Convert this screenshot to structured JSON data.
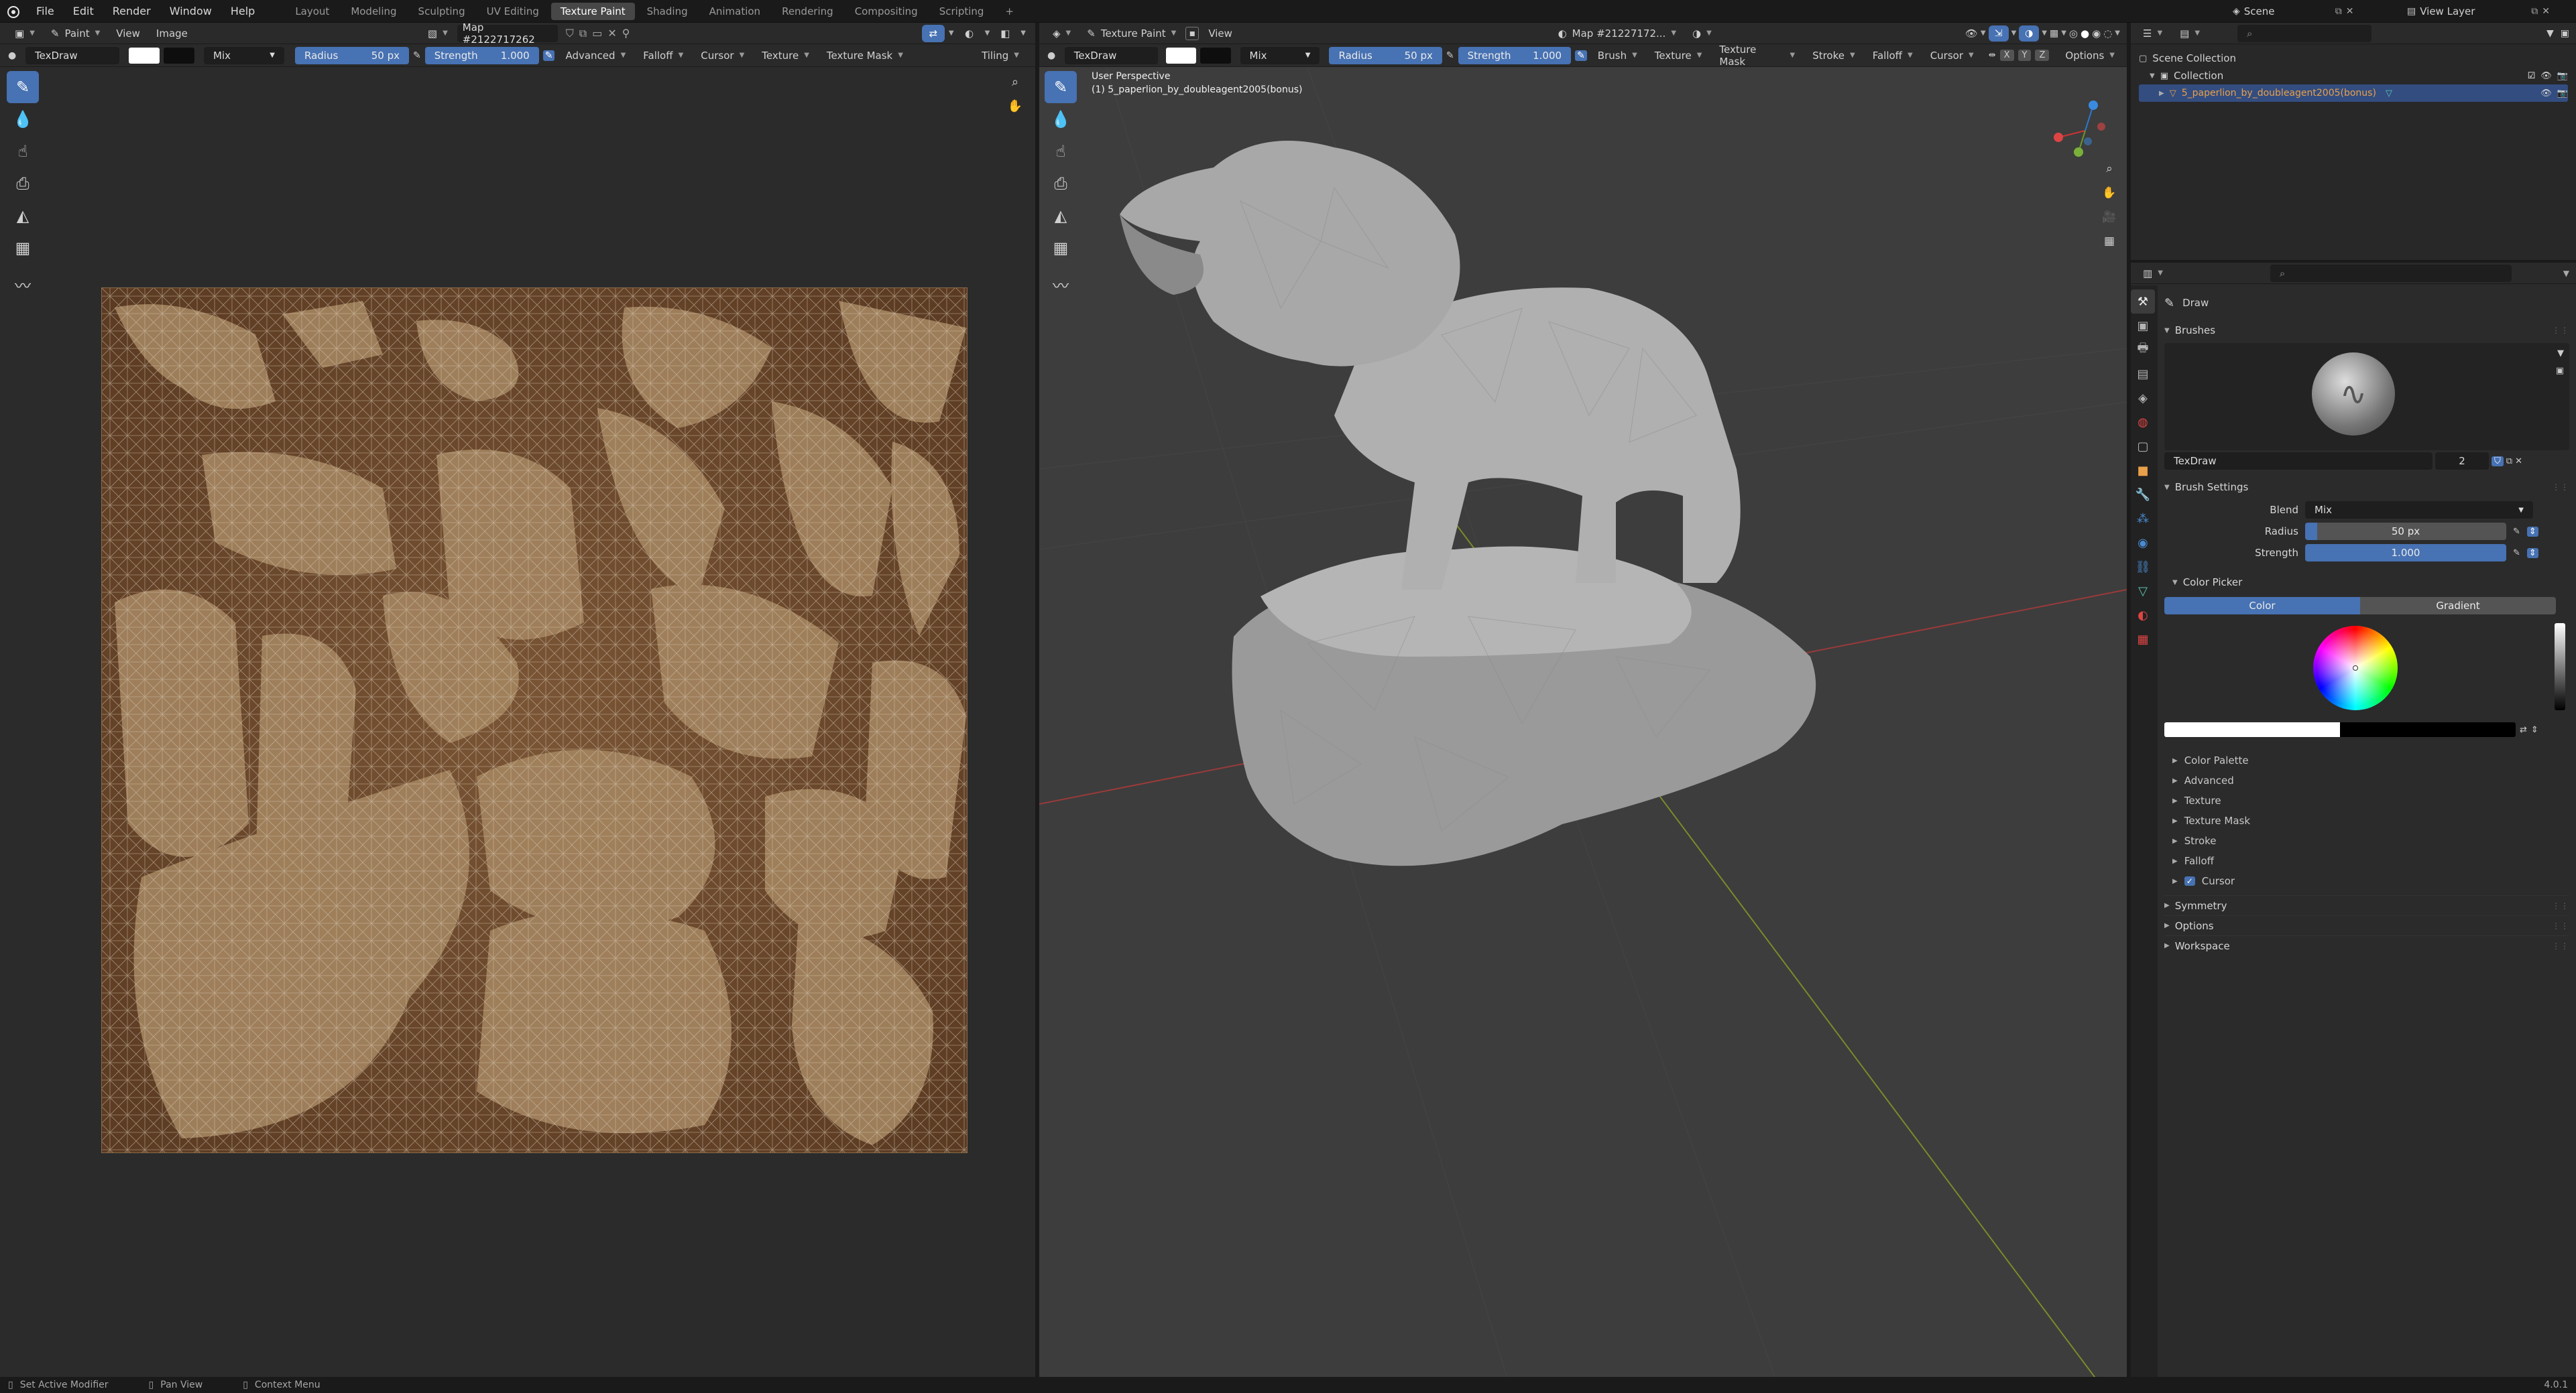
{
  "menubar": {
    "menus": [
      "File",
      "Edit",
      "Render",
      "Window",
      "Help"
    ],
    "workspaces": [
      "Layout",
      "Modeling",
      "Sculpting",
      "UV Editing",
      "Texture Paint",
      "Shading",
      "Animation",
      "Rendering",
      "Compositing",
      "Scripting"
    ],
    "active_workspace": "Texture Paint",
    "add_workspace": "+",
    "scene_label": "Scene",
    "view_layer_label": "View Layer"
  },
  "image_editor": {
    "mode": "Paint",
    "menus": [
      "View",
      "Image"
    ],
    "image_name": "Map #2122717262",
    "tool_header": {
      "brush": "TexDraw",
      "blend": "Mix",
      "radius_label": "Radius",
      "radius_value": "50 px",
      "strength_label": "Strength",
      "strength_value": "1.000",
      "menus": [
        "Advanced",
        "Falloff",
        "Cursor",
        "Texture",
        "Texture Mask"
      ],
      "tiling": "Tiling"
    },
    "tools": [
      "draw-tool",
      "soften-tool",
      "smear-tool",
      "clone-tool",
      "fill-tool",
      "mask-tool",
      "annotate-tool"
    ]
  },
  "viewport": {
    "mode": "Texture Paint",
    "menus": [
      "View"
    ],
    "image_name": "Map #21227172...",
    "tool_header": {
      "brush": "TexDraw",
      "blend": "Mix",
      "radius_label": "Radius",
      "radius_value": "50 px",
      "strength_label": "Strength",
      "strength_value": "1.000",
      "menus": [
        "Brush",
        "Texture",
        "Texture Mask",
        "Stroke",
        "Falloff",
        "Cursor"
      ],
      "options": "Options",
      "axes": [
        "X",
        "Y",
        "Z"
      ]
    },
    "perspective_label": "User Perspective",
    "object_label": "(1) 5_paperlion_by_doubleagent2005(bonus)"
  },
  "outliner": {
    "scene_collection": "Scene Collection",
    "collection": "Collection",
    "object": "5_paperlion_by_doubleagent2005(bonus)"
  },
  "properties": {
    "tool_name": "Draw",
    "brushes_section": "Brushes",
    "brush_name": "TexDraw",
    "brush_users": "2",
    "brush_settings": "Brush Settings",
    "blend_label": "Blend",
    "blend_value": "Mix",
    "radius_label": "Radius",
    "radius_value": "50 px",
    "strength_label": "Strength",
    "strength_value": "1.000",
    "color_picker": "Color Picker",
    "color_tab": "Color",
    "gradient_tab": "Gradient",
    "subsections": [
      "Color Palette",
      "Advanced",
      "Texture",
      "Texture Mask",
      "Stroke",
      "Falloff"
    ],
    "cursor_label": "Cursor",
    "top_sections": [
      "Symmetry",
      "Options",
      "Workspace"
    ]
  },
  "statusbar": {
    "left": "Set Active Modifier",
    "middle": "Pan View",
    "right": "Context Menu",
    "version": "4.0.1"
  },
  "colors": {
    "accent_blue": "#4772b3",
    "texture_base": "#6b4a2e",
    "mesh_gray": "#bdbdbd",
    "viewport_bg": "#3d3d3d"
  }
}
